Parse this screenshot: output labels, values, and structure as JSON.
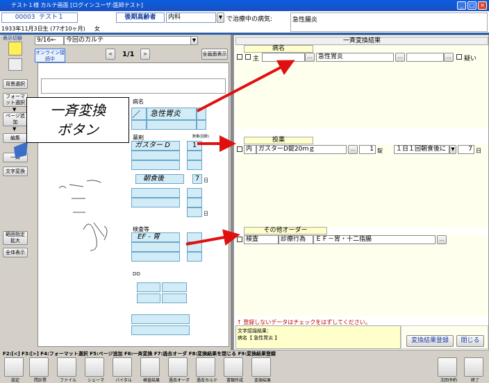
{
  "titlebar": {
    "title": "テスト１様 カルテ画面 [ログインユーザ:医師テスト]"
  },
  "header": {
    "patient_id": "00003",
    "patient_name": "テスト１",
    "insurance": "後期高齢者",
    "department": "内科",
    "dob_age": "1933年11月3日生 (77才10ヶ月)",
    "sex": "女",
    "disease_label": "で治療中の病気:",
    "disease_value": "急性腸炎"
  },
  "left_panel": {
    "display_toggle": "表示切替",
    "buttons": [
      "背景選択",
      "フォーマット選択",
      "ページ追加",
      "編集",
      "一斉",
      "文字変換",
      "範囲指定拡大",
      "全体表示"
    ]
  },
  "karte": {
    "date": "9/16←",
    "title": "今回のカルテ",
    "online_label": "オンライン接続中",
    "page": "1/1",
    "fullscreen": "全画面表示",
    "disease_section": "病名",
    "rx_section": "薬剤",
    "rx_unit_label": "数量(回数)",
    "rx_day": "日",
    "exam_section": "検査等",
    "format_section": "DO",
    "handwrite": {
      "disease": "急性胃炎",
      "drug": "ガスター D",
      "qty": "1",
      "timing": "朝食後",
      "days": "7",
      "exam": "EF - 胃"
    }
  },
  "callout": {
    "line1": "一斉変換",
    "line2": "ボタン"
  },
  "right_panel": {
    "title": "一斉変換結果",
    "disease": {
      "header": "病名",
      "main_label": "主",
      "name": "急性胃炎",
      "doubt_label": "疑い"
    },
    "medicine": {
      "header": "投薬",
      "kind": "内",
      "name": "ガスターD錠20ｍｇ",
      "qty": "1",
      "unit": "錠",
      "timing": "１日１回朝食後に",
      "days": "7",
      "day_unit": "日"
    },
    "other": {
      "header": "その他オーダー",
      "type": "検査",
      "category": "診療行為",
      "name": "ＥＦ－胃・十二指腸"
    },
    "warning": "↑ 登録しないデータはチェックをはずしてください。",
    "recog_label": "文字認識結果：",
    "recog_value": "病名【 急性胃炎 】",
    "register_btn": "変換結果登録",
    "close_btn": "閉じる"
  },
  "shortcuts": "F2:[<]  F3:[>]  F4:フォーマット選択  F5:ページ追加  F6:一斉変換  F7:過去オーダ  F8:変換結果を閉じる  F9:変換結果登録",
  "toolbar": [
    "設定",
    "問診票",
    "ファイル",
    "シェーマ",
    "バイタル",
    "検査結果",
    "過去オーダ",
    "過去カルテ",
    "書類作成",
    "変換結果",
    "次回予約",
    "終了"
  ],
  "colors": {
    "accent": "#2b5fa8",
    "light_blue": "#d2ecf7",
    "yellow": "#ffffcc",
    "arrow": "#e01010"
  }
}
